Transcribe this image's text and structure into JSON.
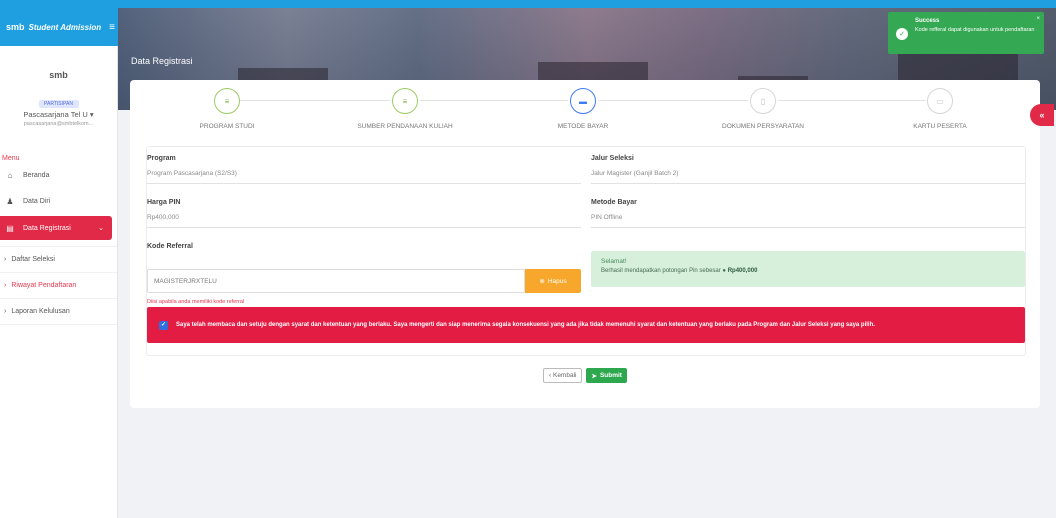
{
  "topbar": {
    "logo": "smb",
    "app_name": "Student Admission",
    "menu_icon": "hamburger-icon"
  },
  "header": {
    "page_title": "Data Registrasi"
  },
  "sidebar": {
    "logo": "smb",
    "badge": "PARTISIPAN",
    "user": "Pascasarjana Tel U ▾",
    "email": "pascasarjana@smbtelkom...",
    "menu_title": "Menu",
    "items": [
      {
        "label": "Beranda",
        "icon": "home-icon"
      },
      {
        "label": "Data Diri",
        "icon": "user-icon"
      },
      {
        "label": "Data Registrasi",
        "icon": "document-icon"
      }
    ],
    "subitems": [
      {
        "label": "Daftar Seleksi"
      },
      {
        "label": "Riwayat Pendaftaran"
      },
      {
        "label": "Laporan Kelulusan"
      }
    ]
  },
  "steps": [
    {
      "label": "PROGRAM STUDI",
      "state": "done"
    },
    {
      "label": "SUMBER PENDANAAN KULIAH",
      "state": "done"
    },
    {
      "label": "METODE BAYAR",
      "state": "current"
    },
    {
      "label": "DOKUMEN PERSYARATAN",
      "state": "todo"
    },
    {
      "label": "KARTU PESERTA",
      "state": "todo"
    }
  ],
  "form": {
    "program_label": "Program",
    "program_value": "Program Pascasarjana (S2/S3)",
    "jalur_label": "Jalur Seleksi",
    "jalur_value": "Jalur Magister (Ganjil Batch 2)",
    "harga_label": "Harga PIN",
    "harga_value": "Rp400,000",
    "metode_label": "Metode Bayar",
    "metode_value": "PIN Offline",
    "referral_label": "Kode Referral",
    "referral_value": "MAGISTERJRXTELU",
    "hapus_label": "Hapus",
    "referral_hint": "Diisi apabila anda memiliki kode referral",
    "alert_title": "Selamat!",
    "alert_text": "Berhasil mendapatkan potongan Pin sebesar",
    "alert_amount": "Rp400,000",
    "agree_text": "Saya telah membaca dan setuju dengan syarat dan ketentuan yang berlaku. Saya mengerti dan siap menerima segala konsekuensi yang ada jika tidak memenuhi syarat dan ketentuan yang berlaku pada Program dan Jalur Seleksi yang saya pilih."
  },
  "actions": {
    "back_label": "‹ Kembali",
    "submit_label": "Submit"
  },
  "toast": {
    "title": "Success",
    "message": "Kode refferal dapat digunakan untuk pendaftaran",
    "color": "#34a853"
  },
  "colors": {
    "primary_red": "#e02a47",
    "accent_blue": "#1f9fe0",
    "success_green": "#2ea84f",
    "warning_orange": "#f7a72b"
  }
}
